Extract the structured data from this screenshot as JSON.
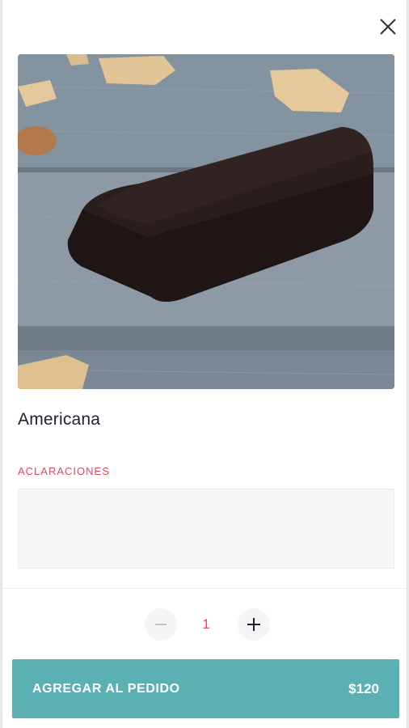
{
  "product": {
    "name": "Americana",
    "image_icon": "product-photo"
  },
  "notes": {
    "label": "ACLARACIONES",
    "value": "",
    "placeholder": ""
  },
  "quantity": {
    "value": "1",
    "minus_icon": "minus-icon",
    "plus_icon": "plus-icon"
  },
  "add_button": {
    "label": "AGREGAR AL PEDIDO",
    "price": "$120"
  },
  "colors": {
    "accent": "#e8475d",
    "button": "#5bb0b3",
    "text": "#1d2233"
  }
}
